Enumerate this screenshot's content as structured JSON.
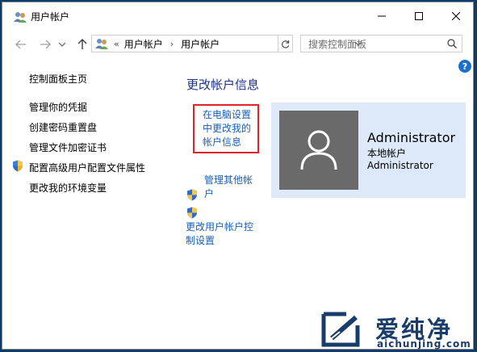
{
  "window": {
    "title": "用户帐户"
  },
  "address": {
    "sep": "«",
    "crumbs": [
      "用户帐户",
      "用户帐户"
    ],
    "crumb_arrow": "›"
  },
  "search": {
    "placeholder": "搜索控制面板"
  },
  "help": {
    "label": "?"
  },
  "nav": {
    "home": "控制面板主页",
    "items": [
      "管理你的凭据",
      "创建密码重置盘",
      "管理文件加密证书",
      "配置高级用户配置文件属性",
      "更改我的环境变量"
    ]
  },
  "main": {
    "title": "更改帐户信息",
    "pc_settings_link": [
      "在电脑设置",
      "中更改我的",
      "帐户信息"
    ],
    "manage_other_link": [
      "管理其他帐",
      "户"
    ],
    "uac_link": [
      "更改用户帐户控",
      "制设置"
    ]
  },
  "account": {
    "name": "Administrator",
    "type": "本地帐户",
    "group": "Administrator"
  },
  "watermark": {
    "text": "爱纯净",
    "url": "aichunjing.com"
  },
  "colors": {
    "link": "#1a5fb4",
    "title": "#1e3287",
    "highlight": "#e0232b",
    "panel": "#dde9f8",
    "avatar": "#6a6a6a"
  }
}
